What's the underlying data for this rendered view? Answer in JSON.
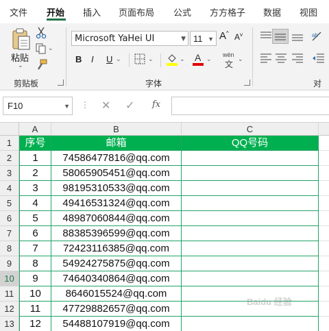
{
  "tabs": [
    "文件",
    "开始",
    "插入",
    "页面布局",
    "公式",
    "方方格子",
    "数据",
    "视图"
  ],
  "active_tab": "开始",
  "ribbon": {
    "paste_label": "粘贴",
    "clipboard_label": "剪贴板",
    "font_group_label": "字体",
    "align_group_label": "对齐",
    "font_name": "Microsoft YaHei UI",
    "font_size": "11",
    "bold": "B",
    "italic": "I",
    "underline": "U",
    "phonetic": "wén",
    "increase_font": "A",
    "decrease_font": "A"
  },
  "formula_bar": {
    "name_box": "F10",
    "fx": "fx",
    "value": ""
  },
  "sheet": {
    "columns": [
      "A",
      "B",
      "C"
    ],
    "row_numbers": [
      "1",
      "2",
      "3",
      "4",
      "5",
      "6",
      "7",
      "8",
      "9",
      "10",
      "11",
      "12",
      "13"
    ],
    "selected_row": "10",
    "header": [
      "序号",
      "邮箱",
      "QQ号码"
    ],
    "rows": [
      [
        "1",
        "74586477816@qq.com",
        ""
      ],
      [
        "2",
        "58065905451@qq.com",
        ""
      ],
      [
        "3",
        "98195310533@qq.com",
        ""
      ],
      [
        "4",
        "49416531324@qq.com",
        ""
      ],
      [
        "5",
        "48987060844@qq.com",
        ""
      ],
      [
        "6",
        "88385396599@qq.com",
        ""
      ],
      [
        "7",
        "72423116385@qq.com",
        ""
      ],
      [
        "8",
        "54924275875@qq.com",
        ""
      ],
      [
        "9",
        "74640340864@qq.com",
        ""
      ],
      [
        "10",
        "8646015524@qq.com",
        ""
      ],
      [
        "11",
        "47729882657@qq.com",
        ""
      ],
      [
        "12",
        "54488107919@qq.com",
        ""
      ]
    ]
  },
  "watermark": "Baidu 经验",
  "colors": {
    "accent": "#217346",
    "header_fill": "#00b050",
    "border": "#21a366"
  }
}
